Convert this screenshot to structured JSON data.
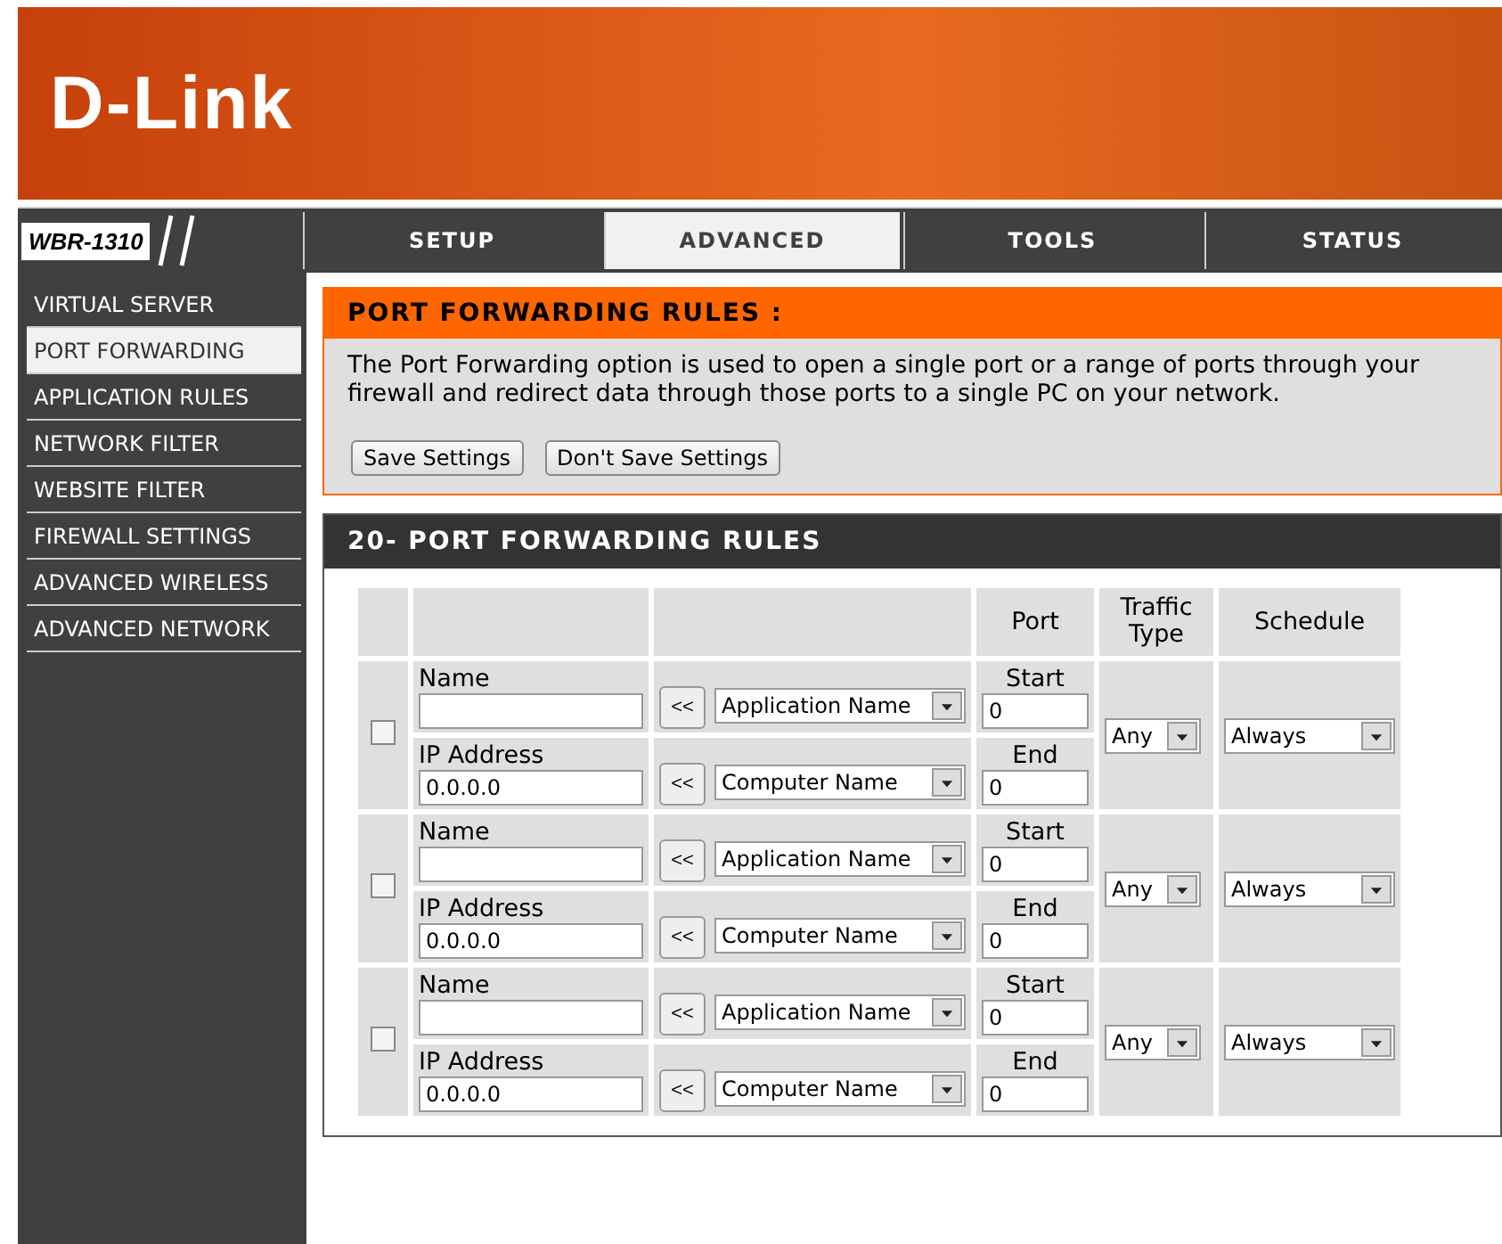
{
  "header": {
    "logo": "D-Link",
    "model": "WBR-1310"
  },
  "tabs": [
    {
      "label": "SETUP",
      "selected": false
    },
    {
      "label": "ADVANCED",
      "selected": true
    },
    {
      "label": "TOOLS",
      "selected": false
    },
    {
      "label": "STATUS",
      "selected": false
    }
  ],
  "sidebar": {
    "items": [
      {
        "label": "VIRTUAL SERVER",
        "selected": false
      },
      {
        "label": "PORT FORWARDING",
        "selected": true
      },
      {
        "label": "APPLICATION RULES",
        "selected": false
      },
      {
        "label": "NETWORK FILTER",
        "selected": false
      },
      {
        "label": "WEBSITE FILTER",
        "selected": false
      },
      {
        "label": "FIREWALL SETTINGS",
        "selected": false
      },
      {
        "label": "ADVANCED WIRELESS",
        "selected": false
      },
      {
        "label": "ADVANCED NETWORK",
        "selected": false
      }
    ]
  },
  "intro": {
    "title": "PORT FORWARDING RULES :",
    "text": "The Port Forwarding option is used to open a single port or a range of ports through your firewall and redirect data through those ports to a single PC on your network.",
    "buttons": [
      "Save Settings",
      "Don't Save Settings"
    ]
  },
  "rules": {
    "title": "20- PORT FORWARDING RULES",
    "columns": [
      "Port",
      "Traffic Type",
      "Schedule"
    ],
    "rows": [
      {
        "checked": false,
        "name_label": "Name",
        "name": "",
        "copy_1": "<<",
        "app": "Application Name",
        "start_label": "Start",
        "start": "0",
        "ip_label": "IP Address",
        "ip": "0.0.0.0",
        "copy_2": "<<",
        "computer": "Computer Name",
        "end_label": "End",
        "end": "0",
        "traffic": "Any",
        "schedule": "Always"
      },
      {
        "checked": false,
        "name_label": "Name",
        "name": "",
        "copy_1": "<<",
        "app": "Application Name",
        "start_label": "Start",
        "start": "0",
        "ip_label": "IP Address",
        "ip": "0.0.0.0",
        "copy_2": "<<",
        "computer": "Computer Name",
        "end_label": "End",
        "end": "0",
        "traffic": "Any",
        "schedule": "Always"
      },
      {
        "checked": false,
        "name_label": "Name",
        "name": "",
        "copy_1": "<<",
        "app": "Application Name",
        "start_label": "Start",
        "start": "0",
        "ip_label": "IP Address",
        "ip": "0.0.0.0",
        "copy_2": "<<",
        "computer": "Computer Name",
        "end_label": "End",
        "end": "0",
        "traffic": "Any",
        "schedule": "Always"
      }
    ]
  }
}
